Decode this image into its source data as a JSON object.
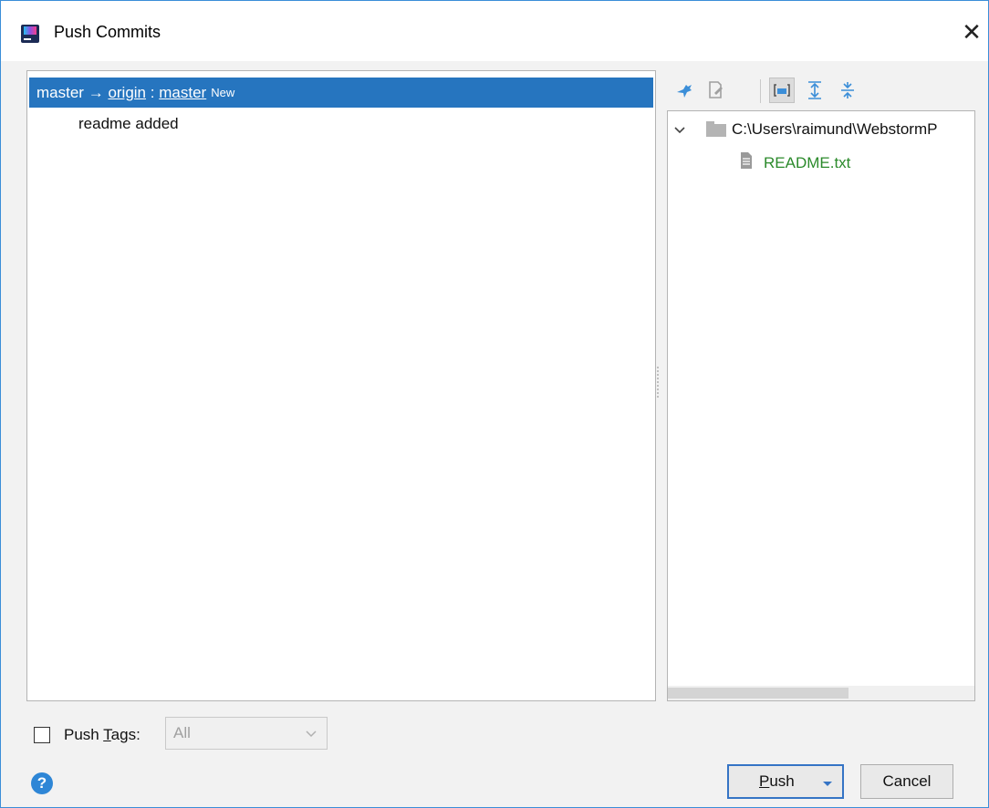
{
  "window": {
    "title": "Push Commits",
    "close_symbol": "✕"
  },
  "commits_panel": {
    "branch": {
      "local": "master",
      "arrow": "→",
      "remote": "origin",
      "sep": ":",
      "remote_branch": "master",
      "tag": "New"
    },
    "commits": [
      {
        "message": "readme added"
      }
    ]
  },
  "toolbar": {
    "icons": [
      "pin-icon",
      "edit-source-icon",
      "group-by-directory-icon",
      "expand-all-icon",
      "collapse-all-icon"
    ],
    "group_toggled": true
  },
  "files_panel": {
    "root_path": "C:\\Users\\raimund\\WebstormP",
    "files": [
      {
        "name": "README.txt",
        "status_color": "#2b8a2b"
      }
    ]
  },
  "push_tags": {
    "label_prefix": "Push ",
    "label_mnemonic": "T",
    "label_suffix": "ags:",
    "checked": false,
    "selected": "All"
  },
  "buttons": {
    "push_mnemonic": "P",
    "push_rest": "ush",
    "cancel": "Cancel"
  },
  "colors": {
    "selection": "#2675bf",
    "accent": "#3574c5",
    "help": "#2e86d6",
    "new_file": "#2b8a2b"
  }
}
